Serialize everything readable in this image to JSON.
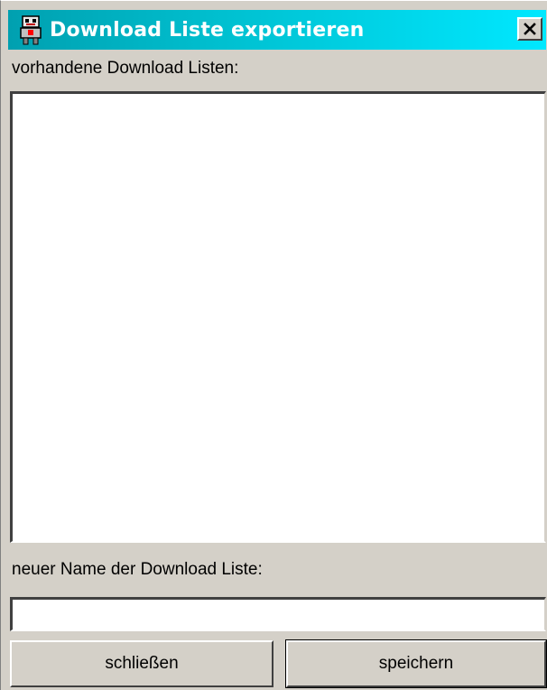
{
  "window": {
    "title": "Download Liste exportieren",
    "title_gradient": [
      "#00a0b0",
      "#00e8ff"
    ],
    "icon": "robot-app-icon"
  },
  "existing_lists": {
    "label": "vorhandene Download Listen:",
    "items": []
  },
  "new_name": {
    "label": "neuer Name der Download Liste:",
    "value": ""
  },
  "buttons": {
    "close_label": "schließen",
    "save_label": "speichern"
  }
}
